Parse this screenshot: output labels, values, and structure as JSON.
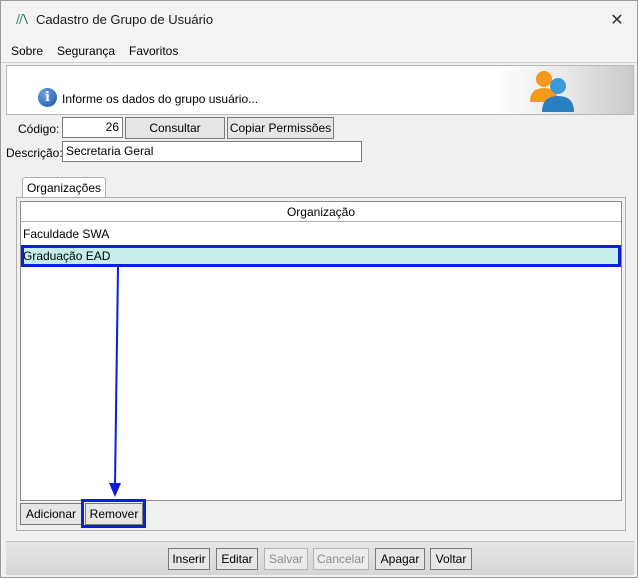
{
  "window": {
    "title": "Cadastro de Grupo de Usuário",
    "close_glyph": "✕"
  },
  "menu": {
    "items": [
      "Sobre",
      "Segurança",
      "Favoritos"
    ]
  },
  "header": {
    "text": "Informe os dados do grupo usuário...",
    "info_glyph": "i"
  },
  "form": {
    "codigo_label": "Código:",
    "codigo_value": "26",
    "consultar_label": "Consultar",
    "copiar_label": "Copiar Permissões",
    "descricao_label": "Descrição:",
    "descricao_value": "Secretaria Geral"
  },
  "tabs": {
    "active": "Organizações"
  },
  "grid": {
    "column": "Organização",
    "rows": [
      "Faculdade SWA",
      "Graduação EAD"
    ],
    "selected_row": 1
  },
  "panel_buttons": {
    "adicionar": "Adicionar",
    "remover": "Remover"
  },
  "toolbar": {
    "inserir": "Inserir",
    "editar": "Editar",
    "salvar": "Salvar",
    "cancelar": "Cancelar",
    "apagar": "Apagar",
    "voltar": "Voltar"
  },
  "colors": {
    "highlight": "#0a1fe0",
    "selection": "#c6ecec"
  }
}
